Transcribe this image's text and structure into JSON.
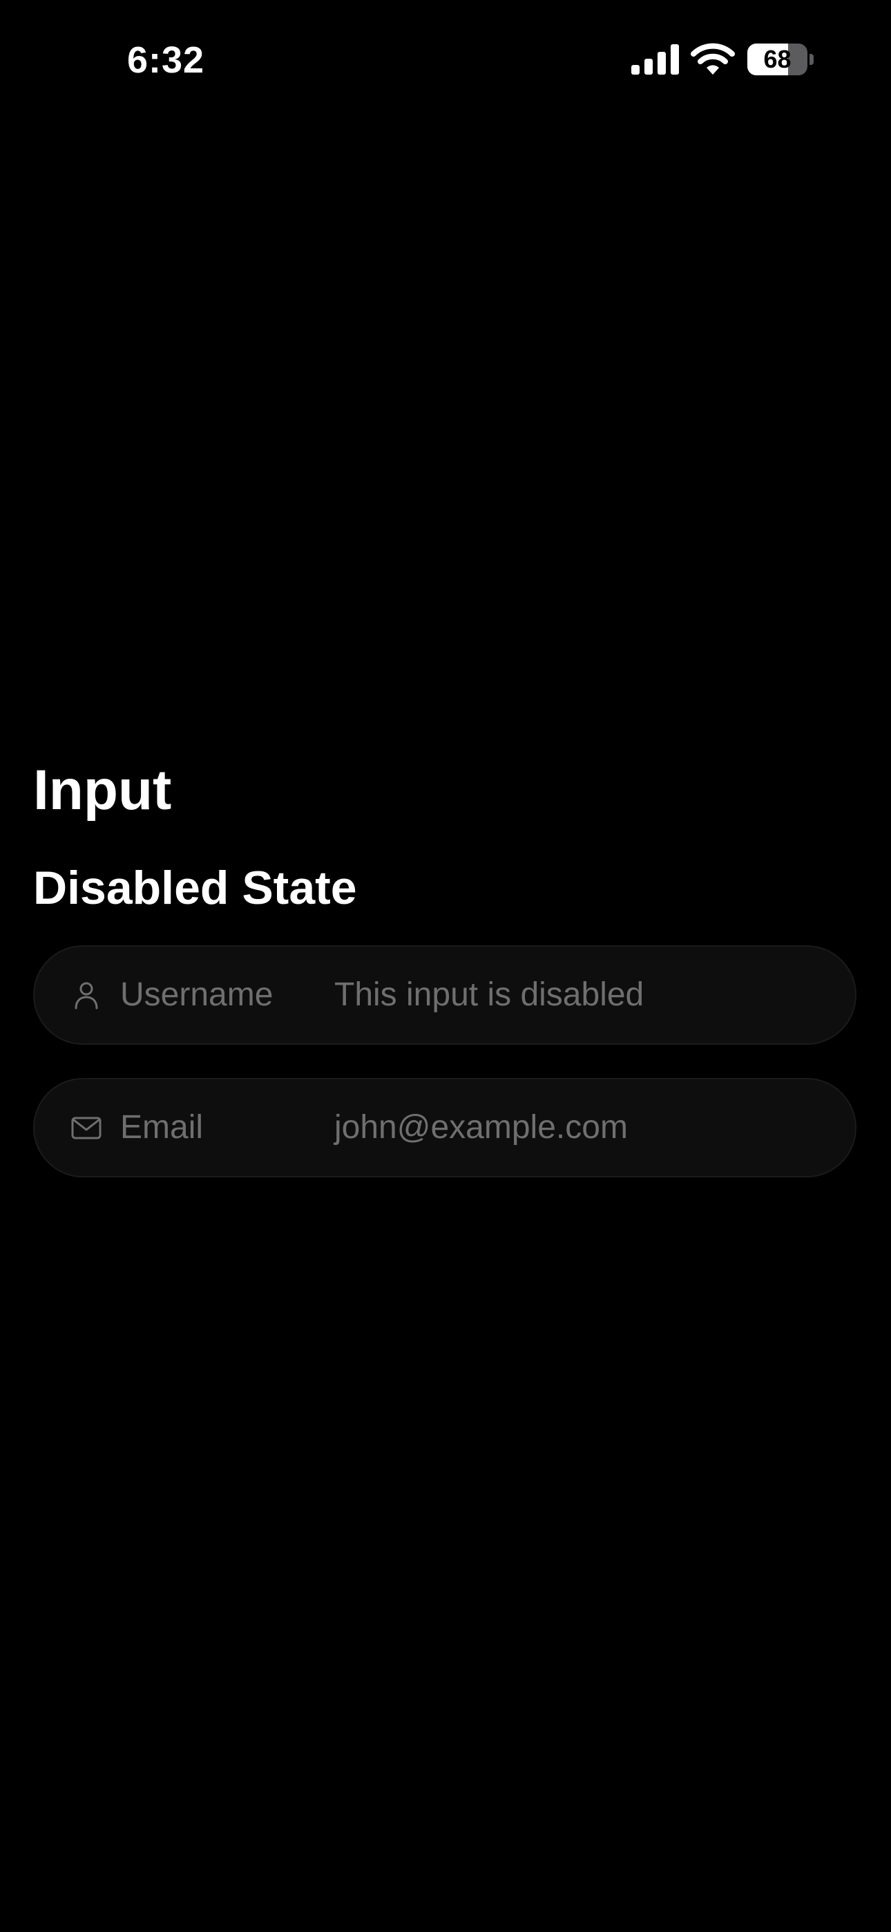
{
  "status_bar": {
    "time": "6:32",
    "battery_percent": "68",
    "battery_level": 0.68,
    "icons": [
      "cellular-signal-icon",
      "wifi-icon",
      "battery-icon"
    ]
  },
  "page": {
    "title": "Input",
    "section_title": "Disabled State"
  },
  "inputs": [
    {
      "icon": "person-icon",
      "label": "Username",
      "value": "This input is disabled",
      "disabled": true
    },
    {
      "icon": "envelope-icon",
      "label": "Email",
      "value": "john@example.com",
      "disabled": true
    }
  ],
  "colors": {
    "background": "#000000",
    "text_primary": "#ffffff",
    "text_disabled": "#6f6f6f",
    "input_background": "#0e0e0e"
  }
}
